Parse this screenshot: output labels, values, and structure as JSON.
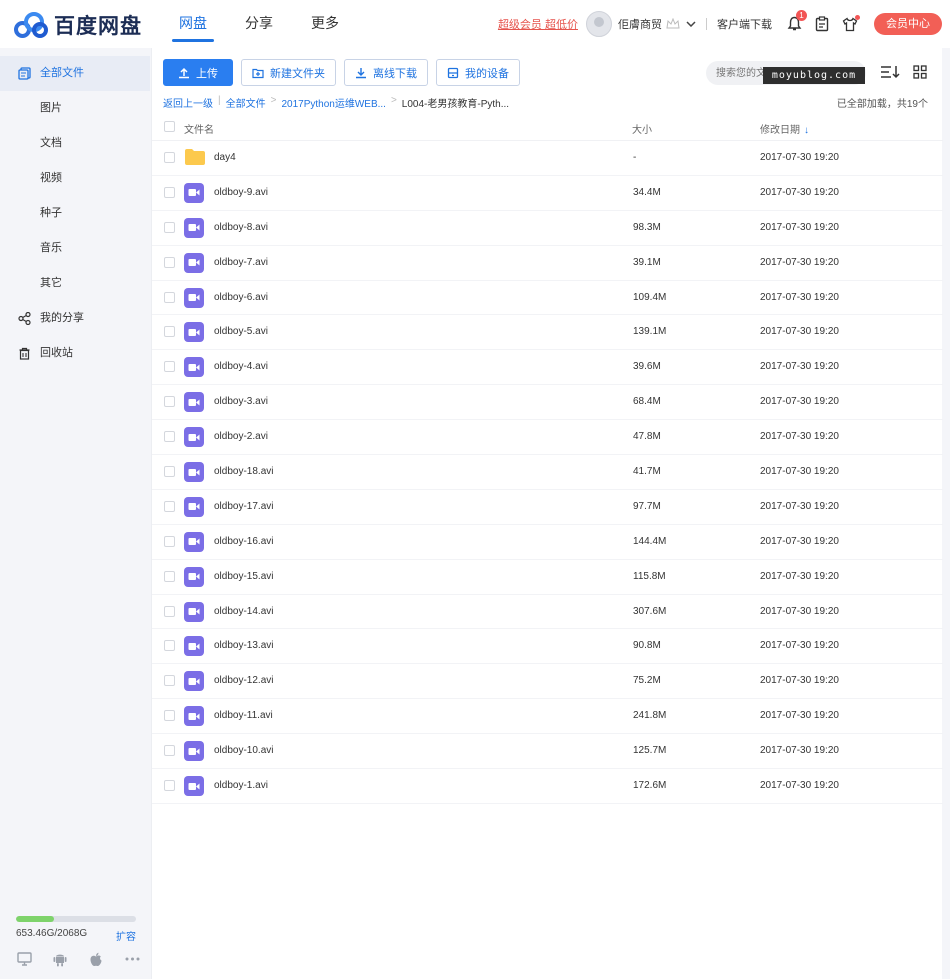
{
  "app": {
    "logo_text": "百度网盘",
    "brand_color": "#2f6fdc"
  },
  "nav": {
    "items": [
      {
        "label": "网盘",
        "active": true
      },
      {
        "label": "分享",
        "active": false
      },
      {
        "label": "更多",
        "active": false
      }
    ]
  },
  "header": {
    "vip_link": "超级会员 超低价",
    "username": "佢膚商贸",
    "client_download": "客户端下载",
    "notification_count": "1",
    "member_center": "会员中心"
  },
  "sidebar": {
    "items": [
      {
        "label": "全部文件",
        "icon": "files-icon",
        "active": true
      },
      {
        "label": "图片",
        "icon": "",
        "active": false
      },
      {
        "label": "文档",
        "icon": "",
        "active": false
      },
      {
        "label": "视频",
        "icon": "",
        "active": false
      },
      {
        "label": "种子",
        "icon": "",
        "active": false
      },
      {
        "label": "音乐",
        "icon": "",
        "active": false
      },
      {
        "label": "其它",
        "icon": "",
        "active": false
      },
      {
        "label": "我的分享",
        "icon": "share-icon",
        "active": false
      },
      {
        "label": "回收站",
        "icon": "trash-icon",
        "active": false
      }
    ],
    "storage": {
      "used_text": "653.46G/2068G",
      "used_fraction": 0.316,
      "expand_label": "扩容"
    }
  },
  "toolbar": {
    "upload": "上传",
    "new_folder": "新建文件夹",
    "offline_download": "离线下载",
    "my_devices": "我的设备"
  },
  "search": {
    "placeholder": "搜索您的文件",
    "watermark": "moyublog.com"
  },
  "breadcrumb": {
    "back": "返回上一级",
    "items": [
      "全部文件",
      "2017Python运维WEB...",
      "L004-老男孩教育-Pyth..."
    ]
  },
  "status": {
    "loaded": "已全部加载，共19个"
  },
  "table": {
    "headers": {
      "name": "文件名",
      "size": "大小",
      "date": "修改日期"
    },
    "rows": [
      {
        "name": "day4",
        "size": "-",
        "date": "2017-07-30 19:20",
        "type": "folder"
      },
      {
        "name": "oldboy-9.avi",
        "size": "34.4M",
        "date": "2017-07-30 19:20",
        "type": "video"
      },
      {
        "name": "oldboy-8.avi",
        "size": "98.3M",
        "date": "2017-07-30 19:20",
        "type": "video"
      },
      {
        "name": "oldboy-7.avi",
        "size": "39.1M",
        "date": "2017-07-30 19:20",
        "type": "video"
      },
      {
        "name": "oldboy-6.avi",
        "size": "109.4M",
        "date": "2017-07-30 19:20",
        "type": "video"
      },
      {
        "name": "oldboy-5.avi",
        "size": "139.1M",
        "date": "2017-07-30 19:20",
        "type": "video"
      },
      {
        "name": "oldboy-4.avi",
        "size": "39.6M",
        "date": "2017-07-30 19:20",
        "type": "video"
      },
      {
        "name": "oldboy-3.avi",
        "size": "68.4M",
        "date": "2017-07-30 19:20",
        "type": "video"
      },
      {
        "name": "oldboy-2.avi",
        "size": "47.8M",
        "date": "2017-07-30 19:20",
        "type": "video"
      },
      {
        "name": "oldboy-18.avi",
        "size": "41.7M",
        "date": "2017-07-30 19:20",
        "type": "video"
      },
      {
        "name": "oldboy-17.avi",
        "size": "97.7M",
        "date": "2017-07-30 19:20",
        "type": "video"
      },
      {
        "name": "oldboy-16.avi",
        "size": "144.4M",
        "date": "2017-07-30 19:20",
        "type": "video"
      },
      {
        "name": "oldboy-15.avi",
        "size": "115.8M",
        "date": "2017-07-30 19:20",
        "type": "video"
      },
      {
        "name": "oldboy-14.avi",
        "size": "307.6M",
        "date": "2017-07-30 19:20",
        "type": "video"
      },
      {
        "name": "oldboy-13.avi",
        "size": "90.8M",
        "date": "2017-07-30 19:20",
        "type": "video"
      },
      {
        "name": "oldboy-12.avi",
        "size": "75.2M",
        "date": "2017-07-30 19:20",
        "type": "video"
      },
      {
        "name": "oldboy-11.avi",
        "size": "241.8M",
        "date": "2017-07-30 19:20",
        "type": "video"
      },
      {
        "name": "oldboy-10.avi",
        "size": "125.7M",
        "date": "2017-07-30 19:20",
        "type": "video"
      },
      {
        "name": "oldboy-1.avi",
        "size": "172.6M",
        "date": "2017-07-30 19:20",
        "type": "video"
      }
    ]
  },
  "colors": {
    "accent": "#1f73e0",
    "video_icon": "#7b6ee6",
    "folder_icon": "#fcc94d",
    "member_button": "#f25f56",
    "storage_fill": "#7ed36b"
  }
}
